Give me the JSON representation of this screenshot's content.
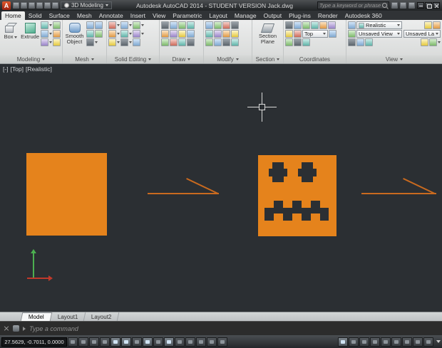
{
  "colors": {
    "viewport_bg": "#2b2f33",
    "pumpkin_orange": "#e5831c",
    "arrow_orange": "#c96a1f",
    "ucs_green": "#4caf50",
    "ucs_red": "#c0392b"
  },
  "title_bar": {
    "app_initial": "A",
    "workspace": "3D Modeling",
    "title": "Autodesk AutoCAD 2014 - STUDENT VERSION   Jack.dwg",
    "search_placeholder": "Type a keyword or phrase"
  },
  "ribbon": {
    "tabs": [
      "Home",
      "Solid",
      "Surface",
      "Mesh",
      "Annotate",
      "Insert",
      "View",
      "Parametric",
      "Layout",
      "Manage",
      "Output",
      "Plug-ins",
      "Render",
      "Autodesk 360"
    ],
    "panels": {
      "modeling": {
        "label": "Modeling",
        "box": "Box",
        "extrude": "Extrude"
      },
      "mesh": {
        "label": "Mesh",
        "smooth_object": "Smooth Object"
      },
      "solid_editing": {
        "label": "Solid Editing"
      },
      "draw": {
        "label": "Draw"
      },
      "modify": {
        "label": "Modify"
      },
      "section": {
        "label": "Section",
        "section_plane": "Section Plane"
      },
      "coordinates": {
        "label": "Coordinates",
        "view_dropdown": "Top"
      },
      "view": {
        "label": "View",
        "visual_style": "Realistic",
        "named_view": "Unsaved View",
        "layer_state": "Unsaved Layer State"
      }
    }
  },
  "viewport": {
    "controls": {
      "menu": "[-]",
      "view": "[Top]",
      "visual_style": "[Realistic]"
    }
  },
  "layout_tabs": {
    "model": "Model",
    "layout1": "Layout1",
    "layout2": "Layout2"
  },
  "command_line": {
    "placeholder": "Type a command"
  },
  "status_bar": {
    "coordinates": "27.5629, -0.7011, 0.0000"
  }
}
